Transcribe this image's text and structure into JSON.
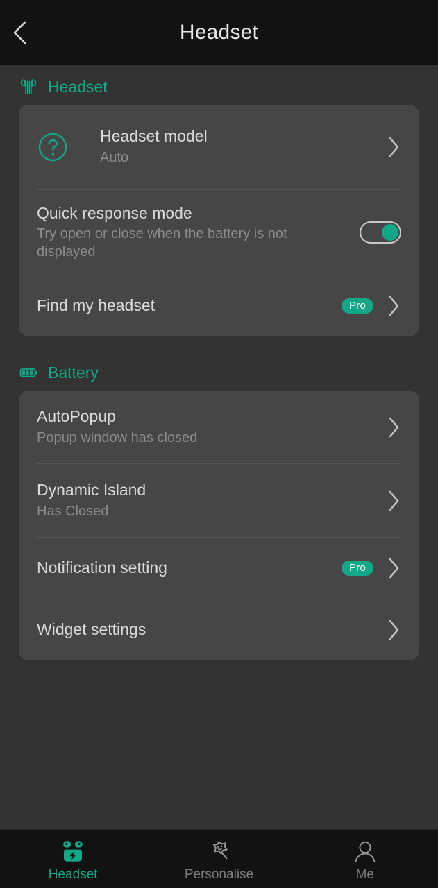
{
  "theme": {
    "accent": "#12a887",
    "page_bg": "#333333",
    "card_bg": "#464646",
    "bar_bg": "#121212",
    "title_text": "#d9d9d9",
    "subtitle_text": "#8c8c8c"
  },
  "topbar": {
    "title": "Headset",
    "back_icon": "chevron-left-icon"
  },
  "sections": [
    {
      "id": "headset",
      "icon": "earbuds-icon",
      "label": "Headset",
      "rows": [
        {
          "id": "headset-model",
          "lead_icon": "question-circle-icon",
          "title": "Headset model",
          "subtitle": "Auto",
          "badge": null,
          "control": "chevron"
        },
        {
          "id": "quick-response-mode",
          "lead_icon": null,
          "title": "Quick response mode",
          "subtitle": "Try open or close when the battery is not displayed",
          "badge": null,
          "control": "toggle",
          "toggle_on": true
        },
        {
          "id": "find-my-headset",
          "lead_icon": null,
          "title": "Find my headset",
          "subtitle": null,
          "badge": "Pro",
          "control": "chevron"
        }
      ]
    },
    {
      "id": "battery",
      "icon": "battery-icon",
      "label": "Battery",
      "rows": [
        {
          "id": "autopopup",
          "lead_icon": null,
          "title": "AutoPopup",
          "subtitle": "Popup window has closed",
          "badge": null,
          "control": "chevron"
        },
        {
          "id": "dynamic-island",
          "lead_icon": null,
          "title": "Dynamic Island",
          "subtitle": "Has Closed",
          "badge": null,
          "control": "chevron"
        },
        {
          "id": "notification-setting",
          "lead_icon": null,
          "title": "Notification setting",
          "subtitle": null,
          "badge": "Pro",
          "control": "chevron"
        },
        {
          "id": "widget-settings",
          "lead_icon": null,
          "title": "Widget settings",
          "subtitle": null,
          "badge": null,
          "control": "chevron"
        }
      ]
    }
  ],
  "bottomnav": {
    "items": [
      {
        "id": "headset",
        "label": "Headset",
        "icon": "earbuds-case-icon",
        "active": true
      },
      {
        "id": "personalise",
        "label": "Personalise",
        "icon": "magic-wand-star-icon",
        "active": false
      },
      {
        "id": "me",
        "label": "Me",
        "icon": "person-icon",
        "active": false
      }
    ]
  }
}
